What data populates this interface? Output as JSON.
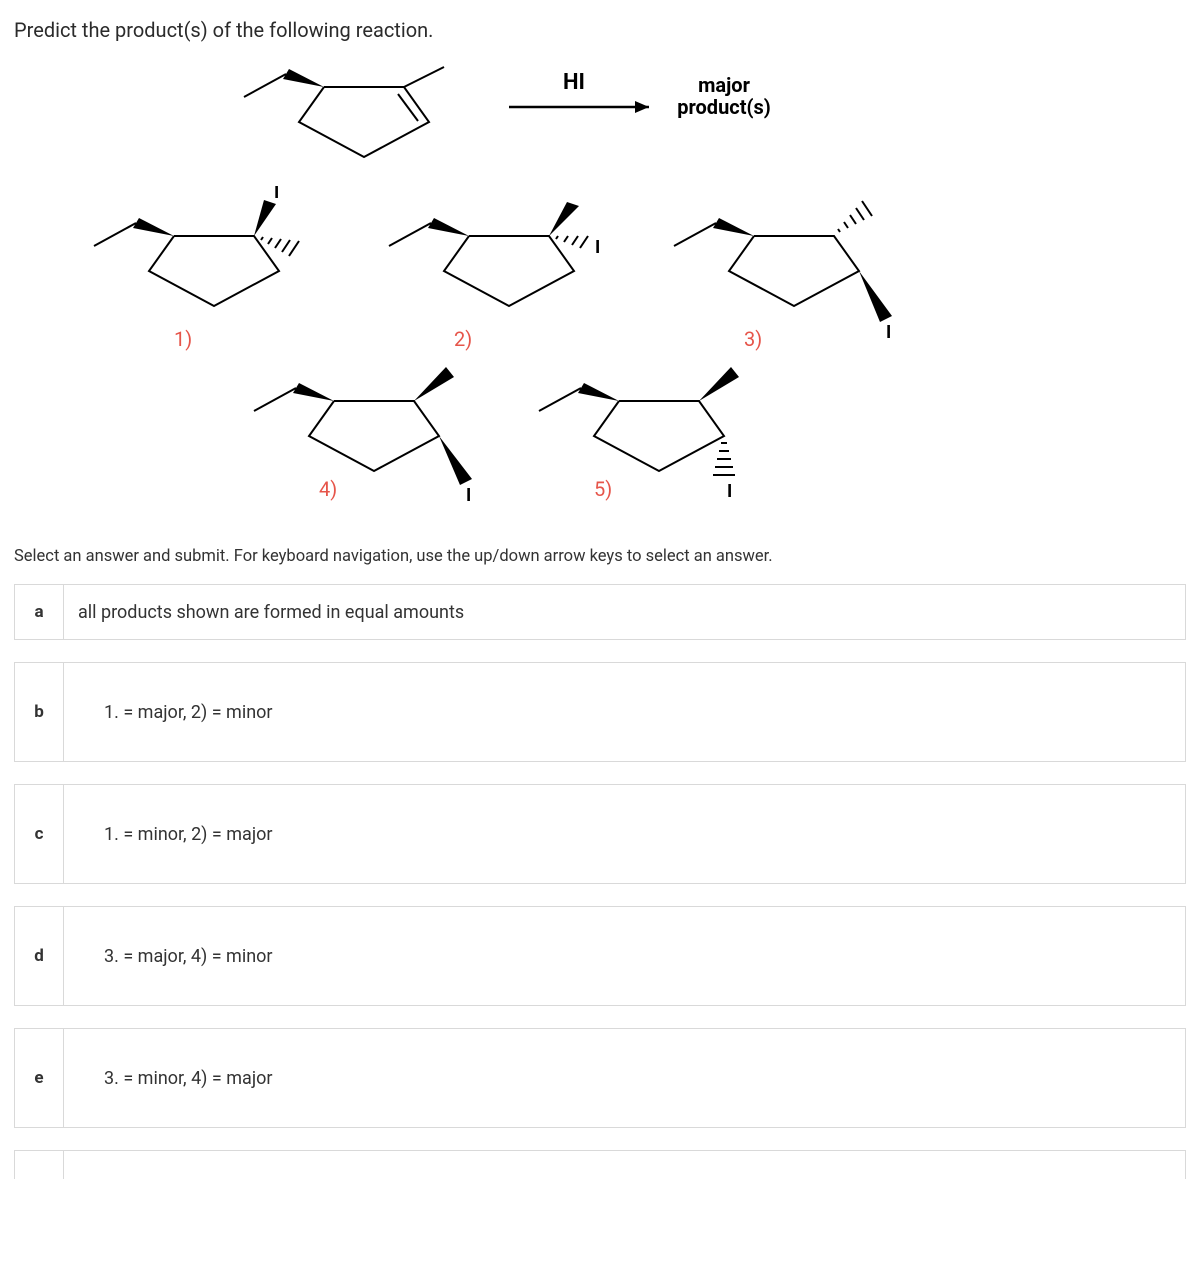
{
  "question": "Predict the product(s) of the following reaction.",
  "reaction": {
    "reagent": "HI",
    "product_label_line1": "major",
    "product_label_line2": "product(s)"
  },
  "structure_labels": {
    "s1": "1)",
    "s2": "2)",
    "s3": "3)",
    "s4": "4)",
    "s5": "5)"
  },
  "atom_label": "I",
  "instruction": "Select an answer and submit. For keyboard navigation, use the up/down arrow keys to select an answer.",
  "answers": [
    {
      "letter": "a",
      "text": "all products shown are formed in equal amounts"
    },
    {
      "letter": "b",
      "text": "1. = major, 2) = minor"
    },
    {
      "letter": "c",
      "text": "1. = minor, 2) = major"
    },
    {
      "letter": "d",
      "text": "3. = major, 4) = minor"
    },
    {
      "letter": "e",
      "text": "3. = minor, 4) = major"
    }
  ]
}
